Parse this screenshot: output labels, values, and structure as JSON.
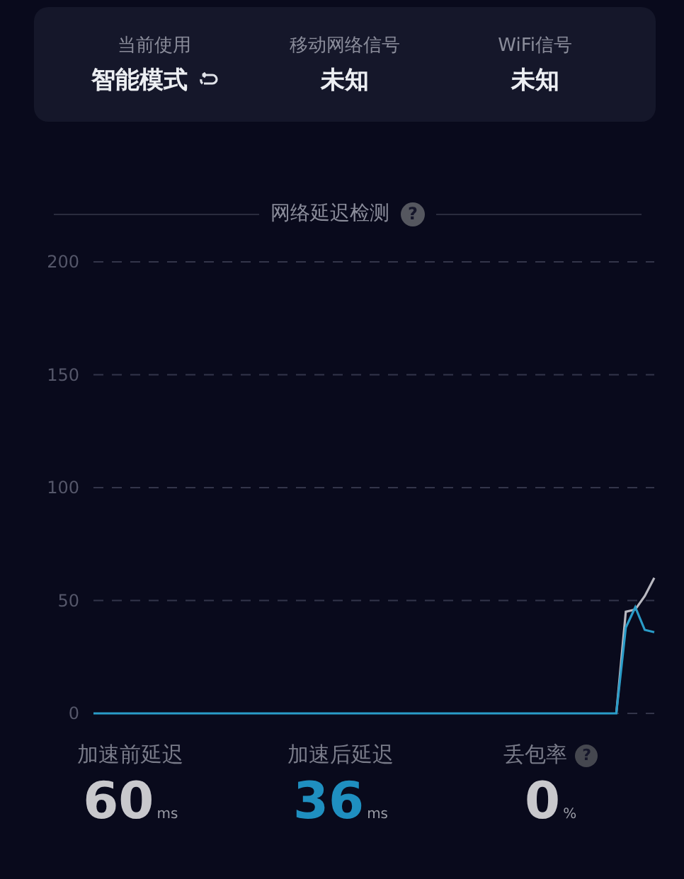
{
  "status_card": {
    "items": [
      {
        "label": "当前使用",
        "value": "智能模式",
        "kind": "mode"
      },
      {
        "label": "移动网络信号",
        "value": "未知",
        "kind": "plain"
      },
      {
        "label": "WiFi信号",
        "value": "未知",
        "kind": "plain"
      }
    ]
  },
  "latency_section": {
    "title": "网络延迟检测",
    "help_icon": "?",
    "chart_data": {
      "type": "line",
      "ylim": [
        0,
        200
      ],
      "yticks": [
        0,
        50,
        100,
        150,
        200
      ],
      "grid": true,
      "series": [
        {
          "color": "#b8b8c0",
          "values": [
            null,
            null,
            null,
            null,
            null,
            null,
            null,
            null,
            null,
            null,
            null,
            null,
            null,
            null,
            null,
            null,
            null,
            null,
            null,
            null,
            null,
            null,
            null,
            null,
            null,
            null,
            null,
            null,
            null,
            null,
            null,
            null,
            null,
            null,
            null,
            null,
            null,
            null,
            null,
            null,
            null,
            null,
            null,
            null,
            null,
            null,
            null,
            null,
            null,
            null,
            null,
            null,
            null,
            null,
            null,
            0,
            45,
            46,
            52,
            60
          ]
        },
        {
          "color": "#2a9cc8",
          "values": [
            0,
            0,
            0,
            0,
            0,
            0,
            0,
            0,
            0,
            0,
            0,
            0,
            0,
            0,
            0,
            0,
            0,
            0,
            0,
            0,
            0,
            0,
            0,
            0,
            0,
            0,
            0,
            0,
            0,
            0,
            0,
            0,
            0,
            0,
            0,
            0,
            0,
            0,
            0,
            0,
            0,
            0,
            0,
            0,
            0,
            0,
            0,
            0,
            0,
            0,
            0,
            0,
            0,
            0,
            0,
            0,
            38,
            47,
            37,
            36
          ]
        }
      ]
    }
  },
  "stats": [
    {
      "label": "加速前延迟",
      "value": "60",
      "unit": "ms",
      "highlight": false
    },
    {
      "label": "加速后延迟",
      "value": "36",
      "unit": "ms",
      "highlight": true
    },
    {
      "label": "丢包率",
      "value": "0",
      "unit": "%",
      "highlight": false,
      "help_icon": "?"
    }
  ]
}
